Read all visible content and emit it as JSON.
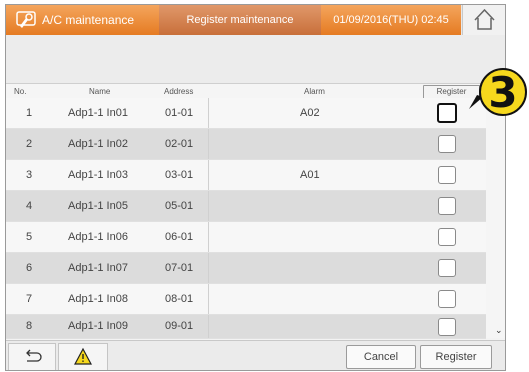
{
  "header": {
    "title": "A/C maintenance",
    "tab": "Register maintenance information",
    "datetime": "01/09/2016(THU) 02:45",
    "app_icon": "wrench-icon",
    "home_icon": "home-icon"
  },
  "table": {
    "columns": [
      "No.",
      "Name",
      "Address",
      "Alarm",
      "Register"
    ],
    "rows": [
      {
        "no": "1",
        "name": "Adp1-1 In01",
        "address": "01-01",
        "alarm": "A02"
      },
      {
        "no": "2",
        "name": "Adp1-1 In02",
        "address": "02-01",
        "alarm": ""
      },
      {
        "no": "3",
        "name": "Adp1-1 In03",
        "address": "03-01",
        "alarm": "A01"
      },
      {
        "no": "4",
        "name": "Adp1-1 In05",
        "address": "05-01",
        "alarm": ""
      },
      {
        "no": "5",
        "name": "Adp1-1 In06",
        "address": "06-01",
        "alarm": ""
      },
      {
        "no": "6",
        "name": "Adp1-1 In07",
        "address": "07-01",
        "alarm": ""
      },
      {
        "no": "7",
        "name": "Adp1-1 In08",
        "address": "08-01",
        "alarm": ""
      },
      {
        "no": "8",
        "name": "Adp1-1 In09",
        "address": "09-01",
        "alarm": ""
      }
    ]
  },
  "footer": {
    "back_icon": "back-arrow-icon",
    "warning_icon": "warning-icon",
    "cancel_label": "Cancel",
    "register_label": "Register"
  },
  "callout": {
    "number": "3"
  },
  "colors": {
    "header_orange": "#e57b22",
    "callout_yellow": "#f6d81d"
  }
}
